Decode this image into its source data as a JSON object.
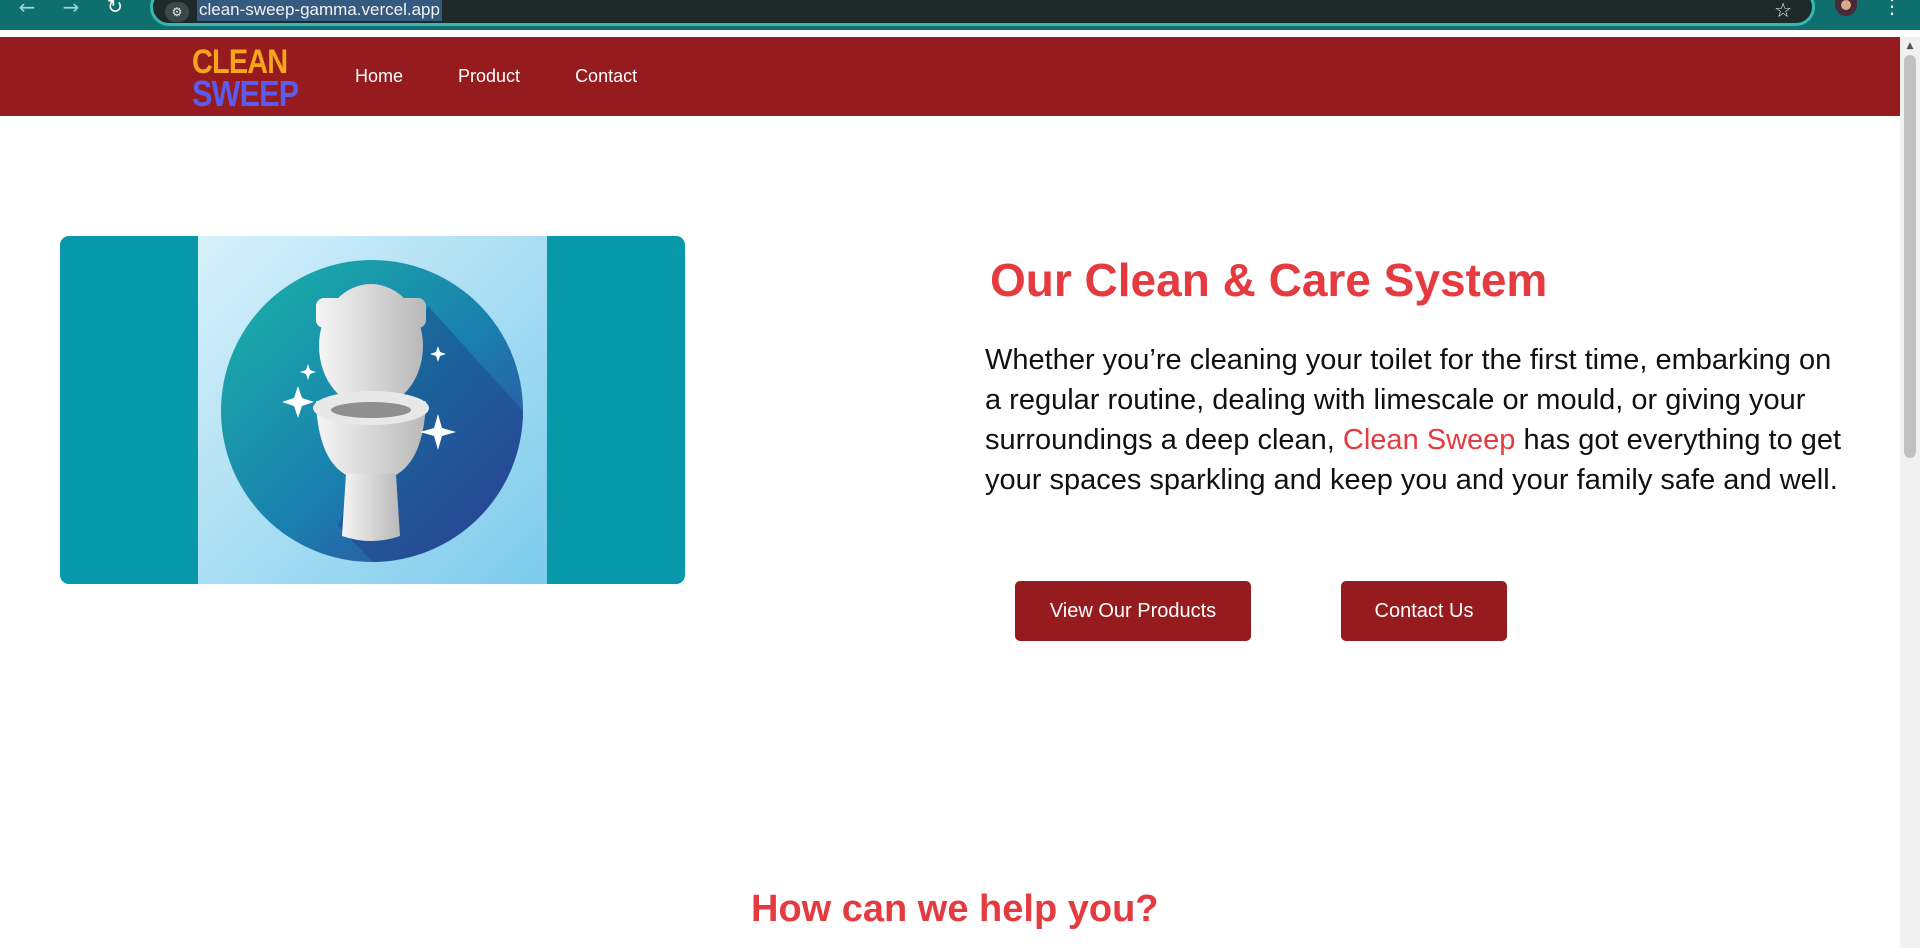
{
  "browser": {
    "url": "clean-sweep-gamma.vercel.app",
    "back_icon": "←",
    "forward_icon": "→",
    "reload_icon": "↻",
    "site_info_icon": "⚙",
    "star_icon": "☆",
    "menu_icon": "⋮"
  },
  "header": {
    "logo_line1": "CLEAN",
    "logo_line2": "SWEEP",
    "nav": [
      {
        "label": "Home"
      },
      {
        "label": "Product"
      },
      {
        "label": "Contact"
      }
    ]
  },
  "hero": {
    "title": "Our Clean & Care System",
    "text_before": "Whether you’re cleaning your toilet for the first time, embarking on a regular routine, dealing with limescale or mould, or giving your surroundings a deep clean, ",
    "brand": "Clean Sweep",
    "text_after": " has got everything to get your spaces sparkling and keep you and your family safe and well.",
    "primary_button": "View Our Products",
    "secondary_button": "Contact Us"
  },
  "help": {
    "title": "How can we help you?"
  },
  "colors": {
    "header_bg": "#961b1e",
    "accent": "#e33b40",
    "image_bg": "#0798aa",
    "logo_orange": "#f4a51c",
    "logo_blue": "#5a5cf0"
  }
}
